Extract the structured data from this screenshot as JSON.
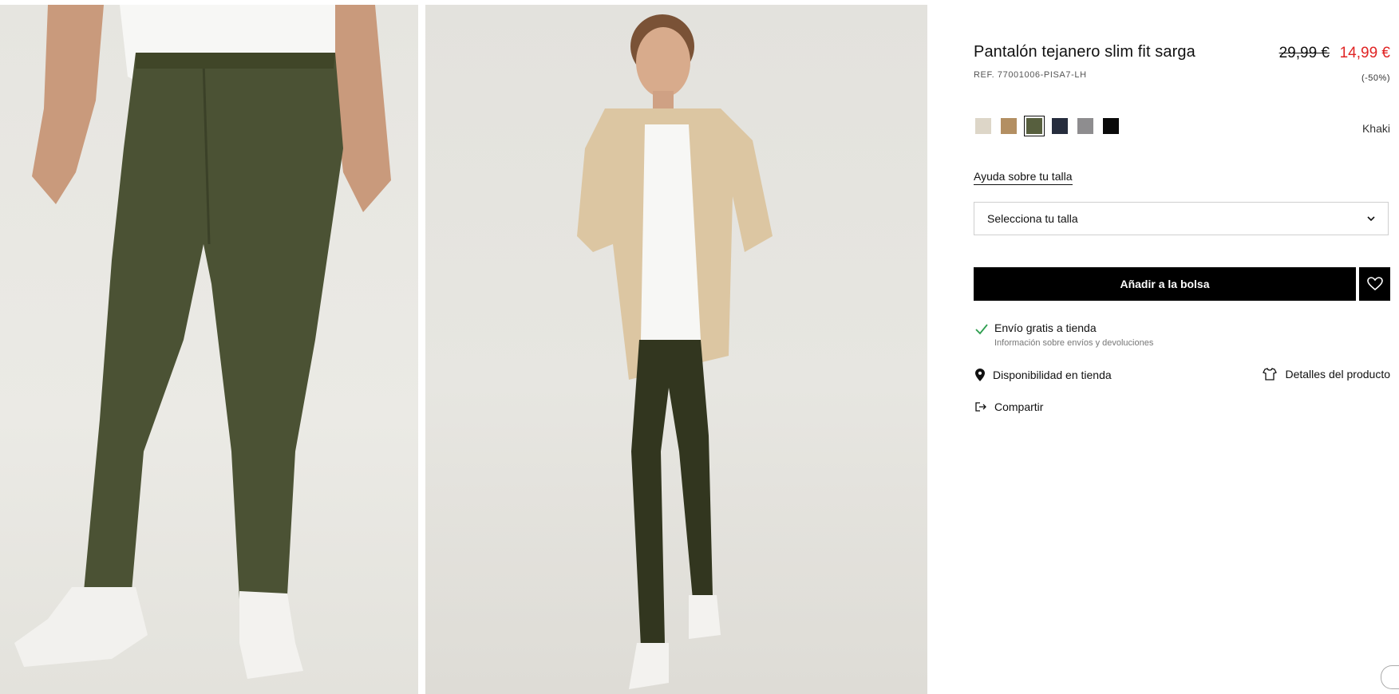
{
  "product": {
    "title": "Pantalón tejanero slim fit sarga",
    "ref": "REF. 77001006-PISA7-LH",
    "price_old": "29,99 €",
    "price_new": "14,99 €",
    "discount": "(-50%)"
  },
  "colors": {
    "selected_name": "Khaki",
    "swatches": [
      {
        "name": "beige-light",
        "hex": "#ddd6c8"
      },
      {
        "name": "tan",
        "hex": "#b38f62"
      },
      {
        "name": "khaki",
        "hex": "#575f3e"
      },
      {
        "name": "navy",
        "hex": "#262d3d"
      },
      {
        "name": "grey",
        "hex": "#8e8d8f"
      },
      {
        "name": "black",
        "hex": "#0a0a0a"
      }
    ]
  },
  "size": {
    "help_link": "Ayuda sobre tu talla",
    "select_placeholder": "Selecciona tu talla"
  },
  "actions": {
    "add_to_bag": "Añadir a la bolsa"
  },
  "shipping": {
    "title": "Envío gratis a tienda",
    "info": "Información sobre envíos y devoluciones"
  },
  "links": {
    "store_availability": "Disponibilidad en tienda",
    "product_details": "Detalles del producto",
    "share": "Compartir"
  },
  "theme": {
    "accent_sale": "#e02424",
    "check_green": "#2e9e4f"
  }
}
